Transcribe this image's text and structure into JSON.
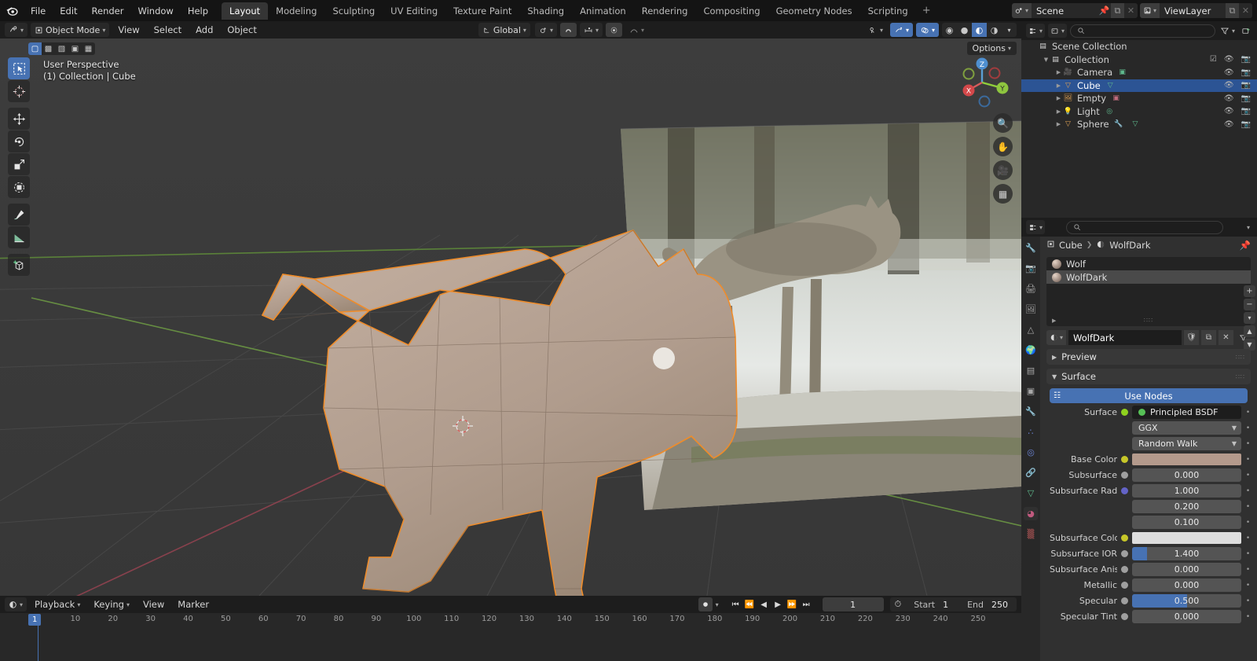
{
  "app": {
    "name": "Blender",
    "accent": "#4772b3",
    "bg": "#1d1d1d"
  },
  "topbar": {
    "menus": [
      "File",
      "Edit",
      "Render",
      "Window",
      "Help"
    ],
    "workspaces": [
      {
        "label": "Layout",
        "active": true
      },
      {
        "label": "Modeling",
        "active": false
      },
      {
        "label": "Sculpting",
        "active": false
      },
      {
        "label": "UV Editing",
        "active": false
      },
      {
        "label": "Texture Paint",
        "active": false
      },
      {
        "label": "Shading",
        "active": false
      },
      {
        "label": "Animation",
        "active": false
      },
      {
        "label": "Rendering",
        "active": false
      },
      {
        "label": "Compositing",
        "active": false
      },
      {
        "label": "Geometry Nodes",
        "active": false
      },
      {
        "label": "Scripting",
        "active": false
      }
    ],
    "add_workspace_label": "+",
    "scene": {
      "name": "Scene",
      "icon": "scene-icon"
    },
    "viewlayer": {
      "name": "ViewLayer",
      "icon": "viewlayer-icon"
    }
  },
  "viewport_header": {
    "editor_type_icon": "editor-type-icon",
    "mode": "Object Mode",
    "menus": [
      "View",
      "Select",
      "Add",
      "Object"
    ],
    "transform_orientation": "Global",
    "pivot_icon": "pivot-icon",
    "snap_icon": "snap-magnet-icon",
    "proportional_icon": "proportional-edit-icon",
    "gizmo_icon": "gizmo-icon",
    "overlays_icon": "overlays-icon",
    "xray_icon": "xray-icon",
    "shading_modes": [
      "wireframe",
      "solid",
      "material-preview",
      "rendered"
    ],
    "shading_active": "material-preview",
    "options_label": "Options"
  },
  "viewport": {
    "perspective": "User Perspective",
    "scene_info": "(1) Collection | Cube",
    "select_modes": [
      "tweak",
      "box-select",
      "circle-select",
      "lasso-select",
      "select-box-alt"
    ],
    "tools": [
      {
        "name": "tweak-tool",
        "active": true
      },
      {
        "name": "cursor-tool",
        "active": false
      },
      {
        "name": "move-tool",
        "active": false
      },
      {
        "name": "rotate-tool",
        "active": false
      },
      {
        "name": "scale-tool",
        "active": false
      },
      {
        "name": "transform-tool",
        "active": false
      },
      {
        "name": "annotate-tool",
        "active": false
      },
      {
        "name": "measure-tool",
        "active": false
      },
      {
        "name": "add-cube-tool",
        "active": false
      }
    ],
    "gizmo_axes": [
      "X",
      "Y",
      "Z"
    ],
    "nav_buttons": [
      "zoom-icon",
      "pan-icon",
      "camera-icon",
      "perspective-toggle-icon"
    ]
  },
  "outliner": {
    "display_mode_icon": "display-mode-icon",
    "filter_icon": "filter-icon",
    "search_placeholder": "",
    "new_collection_icon": "new-collection-icon",
    "rows": [
      {
        "name": "Scene Collection",
        "icon": "collection-icon",
        "indent": 0,
        "selected": false,
        "expand": "",
        "data_icons": [],
        "checkbox": false,
        "eye": false,
        "camera": false
      },
      {
        "name": "Collection",
        "icon": "collection-icon",
        "indent": 1,
        "selected": false,
        "expand": "down",
        "data_icons": [],
        "checkbox": true,
        "eye": true,
        "camera": true
      },
      {
        "name": "Camera",
        "icon": "camera-object-icon",
        "indent": 2,
        "selected": false,
        "expand": "right",
        "data_icons": [
          "camera-data-icon"
        ],
        "checkbox": false,
        "eye": true,
        "camera": true
      },
      {
        "name": "Cube",
        "icon": "mesh-object-icon",
        "indent": 2,
        "selected": true,
        "expand": "right",
        "data_icons": [
          "mesh-data-icon"
        ],
        "checkbox": false,
        "eye": true,
        "camera": true
      },
      {
        "name": "Empty",
        "icon": "empty-image-icon",
        "indent": 2,
        "selected": false,
        "expand": "right",
        "data_icons": [
          "image-data-icon"
        ],
        "checkbox": false,
        "eye": true,
        "camera": true
      },
      {
        "name": "Light",
        "icon": "light-object-icon",
        "indent": 2,
        "selected": false,
        "expand": "right",
        "data_icons": [
          "light-data-icon"
        ],
        "checkbox": false,
        "eye": true,
        "camera": true
      },
      {
        "name": "Sphere",
        "icon": "mesh-object-icon",
        "indent": 2,
        "selected": false,
        "expand": "right",
        "data_icons": [
          "modifier-icon",
          "mesh-data-icon"
        ],
        "checkbox": false,
        "eye": true,
        "camera": true
      }
    ]
  },
  "properties": {
    "editor_icon": "properties-editor-icon",
    "search_placeholder": "",
    "tabs": [
      {
        "name": "tool",
        "active": false
      },
      {
        "name": "render",
        "active": false
      },
      {
        "name": "output",
        "active": false
      },
      {
        "name": "view-layer",
        "active": false
      },
      {
        "name": "scene",
        "active": false
      },
      {
        "name": "world",
        "active": false
      },
      {
        "name": "collection",
        "active": false
      },
      {
        "name": "object",
        "active": false
      },
      {
        "name": "modifiers",
        "active": false
      },
      {
        "name": "particles",
        "active": false
      },
      {
        "name": "physics",
        "active": false
      },
      {
        "name": "constraints",
        "active": false
      },
      {
        "name": "object-data",
        "active": false
      },
      {
        "name": "material",
        "active": true
      },
      {
        "name": "texture",
        "active": false
      }
    ],
    "breadcrumb": {
      "object": "Cube",
      "material": "WolfDark"
    },
    "material_slots": [
      {
        "name": "Wolf",
        "selected": false
      },
      {
        "name": "WolfDark",
        "selected": true
      }
    ],
    "slot_buttons": [
      "add-slot-button",
      "remove-slot-button",
      "slot-specials-button",
      "move-slot-up-button",
      "move-slot-down-button"
    ],
    "material_name": "WolfDark",
    "material_buttons": [
      "fake-user-button",
      "new-material-button",
      "unlink-material-button",
      "browse-material-button"
    ],
    "panels": [
      {
        "label": "Preview",
        "open": false
      },
      {
        "label": "Surface",
        "open": true
      }
    ],
    "use_nodes_label": "Use Nodes",
    "rows": [
      {
        "label": "Surface",
        "type": "enum",
        "value": "Principled BSDF",
        "socket": "#8fd21f",
        "style": "dark"
      },
      {
        "label": "",
        "type": "dropdown",
        "value": "GGX",
        "socket": null,
        "style": "drop"
      },
      {
        "label": "",
        "type": "dropdown",
        "value": "Random Walk",
        "socket": null,
        "style": "drop"
      },
      {
        "label": "Base Color",
        "type": "color",
        "value": "#b49a8c",
        "socket": "#c7c729",
        "style": "color"
      },
      {
        "label": "Subsurface",
        "type": "value",
        "value": "0.000",
        "socket": "#9f9f9f",
        "style": "slider",
        "fill": 0
      },
      {
        "label": "Subsurface Radius",
        "type": "value",
        "value": "1.000",
        "socket": "#6363c7",
        "style": "slider",
        "fill": 0
      },
      {
        "label": "",
        "type": "value",
        "value": "0.200",
        "socket": null,
        "style": "slider",
        "fill": 0
      },
      {
        "label": "",
        "type": "value",
        "value": "0.100",
        "socket": null,
        "style": "slider",
        "fill": 0
      },
      {
        "label": "Subsurface Color",
        "type": "color",
        "value": "#dedede",
        "socket": "#c7c729",
        "style": "color"
      },
      {
        "label": "Subsurface IOR",
        "type": "value",
        "value": "1.400",
        "socket": "#9f9f9f",
        "style": "slider",
        "fill": 14
      },
      {
        "label": "Subsurface Aniso…",
        "type": "value",
        "value": "0.000",
        "socket": "#9f9f9f",
        "style": "slider",
        "fill": 0
      },
      {
        "label": "Metallic",
        "type": "value",
        "value": "0.000",
        "socket": "#9f9f9f",
        "style": "slider",
        "fill": 0
      },
      {
        "label": "Specular",
        "type": "value",
        "value": "0.500",
        "socket": "#9f9f9f",
        "style": "slider",
        "fill": 50
      },
      {
        "label": "Specular Tint",
        "type": "value",
        "value": "0.000",
        "socket": "#9f9f9f",
        "style": "slider",
        "fill": 0
      }
    ]
  },
  "timeline": {
    "editor_icon": "timeline-editor-icon",
    "menus": [
      "Playback",
      "Keying",
      "View",
      "Marker"
    ],
    "auto_key_icon": "auto-keyframe-icon",
    "transport": [
      "jump-to-start",
      "jump-to-keyframe-prev",
      "play-reverse",
      "play",
      "jump-to-keyframe-next",
      "jump-to-end"
    ],
    "current_frame": "1",
    "start_label": "Start",
    "start_value": "1",
    "end_label": "End",
    "end_value": "250",
    "ticks": [
      "1",
      "10",
      "20",
      "30",
      "40",
      "50",
      "60",
      "70",
      "80",
      "90",
      "100",
      "110",
      "120",
      "130",
      "140",
      "150",
      "160",
      "170",
      "180",
      "190",
      "200",
      "210",
      "220",
      "230",
      "240",
      "250"
    ],
    "playhead_frame": "1"
  }
}
